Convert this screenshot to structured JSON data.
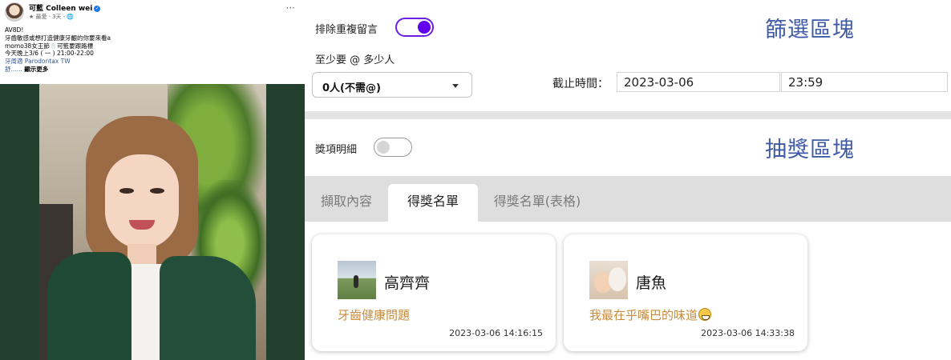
{
  "fb_post": {
    "author": "可藍 Colleen wei",
    "meta": "★ 最愛 · 3天 · 🌐",
    "more_label": "···",
    "lines": [
      "AV8D!",
      "牙齒敏感或想打造健康牙齦的你要來看a",
      "momo38女王節🦷可藍要跟路標",
      "今天晚上3/6 ( 一 )   21:00-22:00"
    ],
    "link_text": "牙周適 Parodontax TW",
    "ellipsis_text": "舒......",
    "see_more": "顯示更多"
  },
  "filter": {
    "dedupe_label": "排除重複留言",
    "dedupe_on": true,
    "min_mention_label": "至少要 @ 多少人",
    "min_mention_value": "0人(不需@)",
    "deadline_label": "截止時間：",
    "deadline_date": "2023-03-06",
    "deadline_time": "23:59",
    "block_title": "篩選區塊"
  },
  "lottery": {
    "prize_detail_label": "獎項明細",
    "prize_detail_on": false,
    "block_title": "抽獎區塊"
  },
  "tabs": [
    {
      "label": "擷取內容",
      "active": false
    },
    {
      "label": "得獎名單",
      "active": true
    },
    {
      "label": "得獎名單(表格)",
      "active": false
    }
  ],
  "winners": [
    {
      "name": "高齊齊",
      "comment": "牙齒健康問題",
      "time": "2023-03-06 14:16:15"
    },
    {
      "name": "唐魚",
      "comment": "我最在乎嘴巴的味道",
      "time": "2023-03-06 14:33:38"
    }
  ],
  "colors": {
    "accent": "#6200ee",
    "title_blue": "#3f5aa8",
    "comment_orange": "#c98b3c",
    "tab_bar": "#dedede"
  }
}
